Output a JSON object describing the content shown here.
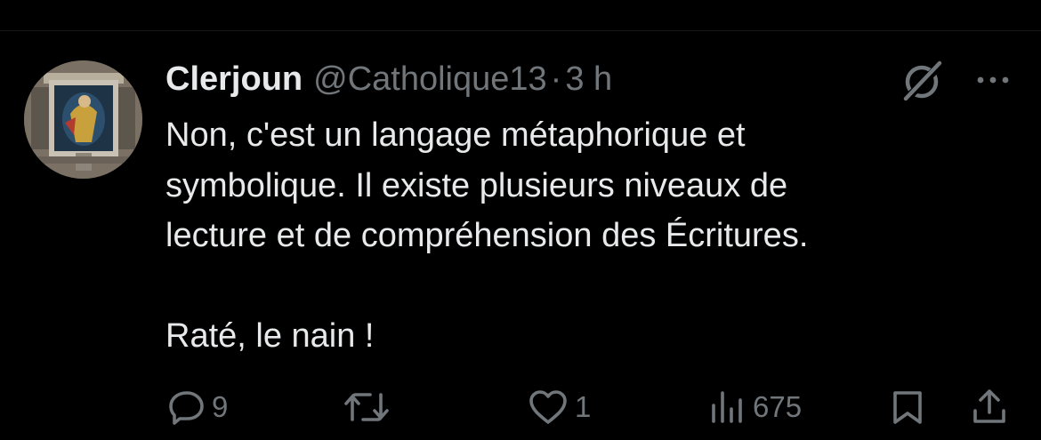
{
  "tweet": {
    "display_name": "Clerjoun",
    "handle": "@Catholique13",
    "separator": "·",
    "time": "3 h",
    "text_lines": [
      "Non, c'est un langage métaphorique et",
      "symbolique. Il existe plusieurs niveaux de",
      "lecture et de compréhension des Écritures.",
      "",
      "Raté, le nain !"
    ]
  },
  "actions": {
    "replies": "9",
    "retweets": "",
    "likes": "1",
    "views": "675"
  },
  "icons": {
    "reply": "reply-icon",
    "retweet": "retweet-icon",
    "like": "heart-icon",
    "views": "views-icon",
    "bookmark": "bookmark-icon",
    "share": "share-icon",
    "grok": "grok-icon",
    "more": "more-icon"
  },
  "colors": {
    "background": "#000000",
    "text": "#e7e9ea",
    "muted": "#71767b"
  }
}
